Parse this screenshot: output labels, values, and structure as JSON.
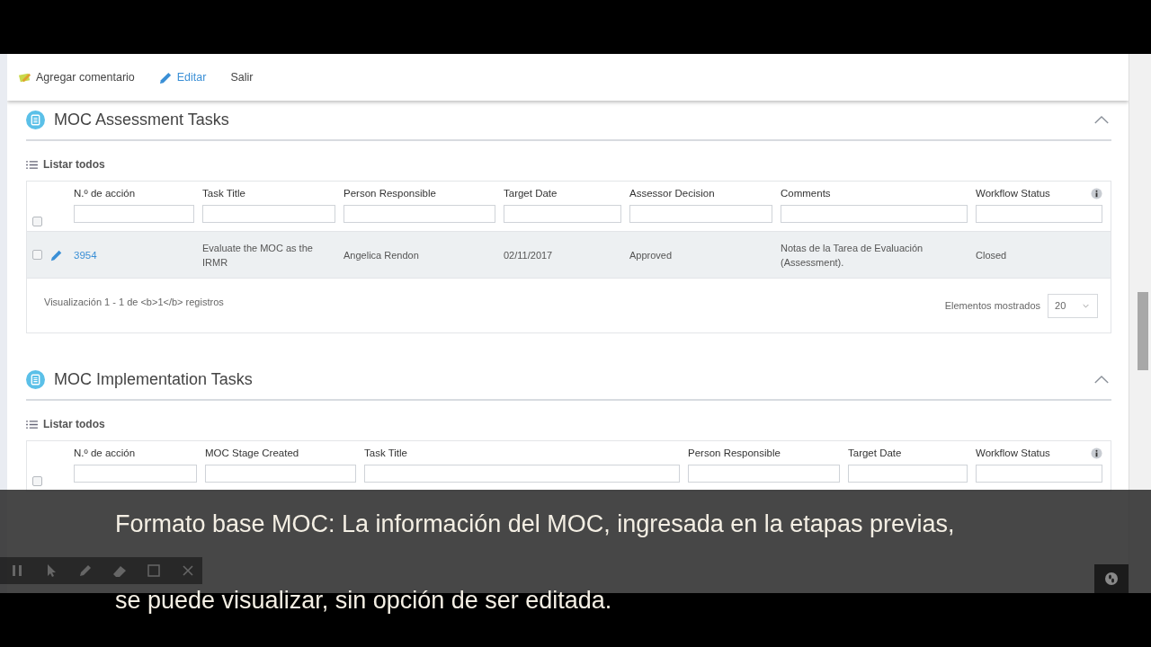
{
  "toolbar": {
    "items": [
      {
        "kind": "comment",
        "label": "Agregar comentario"
      },
      {
        "kind": "edit",
        "label": "Editar"
      },
      {
        "kind": "plain",
        "label": "Salir"
      }
    ]
  },
  "sections": [
    {
      "title": "MOC Assessment Tasks",
      "expanded": true,
      "list_all": "Listar todos",
      "table": {
        "all_checked": false,
        "columns": [
          {
            "label": "N.º de acción"
          },
          {
            "label": "Task Title"
          },
          {
            "label": "Person Responsible"
          },
          {
            "label": "Target Date"
          },
          {
            "label": "Assessor Decision"
          },
          {
            "label": "Comments"
          },
          {
            "label": "Workflow Status",
            "info": true
          }
        ],
        "rows": [
          {
            "checked": false,
            "highlighted": true,
            "cells": [
              "3954",
              "Evaluate the MOC as the IRMR",
              "Angelica Rendon",
              "02/11/2017",
              "Approved",
              "Notas de la Tarea de Evaluación (Assessment).",
              "Closed"
            ]
          }
        ]
      },
      "footer": {
        "summary": "Visualización 1 - 1 de <b>1</b> registros",
        "page_size_label": "Elementos mostrados",
        "page_size": "20"
      }
    },
    {
      "title": "MOC Implementation Tasks",
      "expanded": true,
      "list_all": "Listar todos",
      "table": {
        "all_checked": false,
        "columns": [
          {
            "label": "N.º de acción"
          },
          {
            "label": "MOC Stage Created"
          },
          {
            "label": "Task Title"
          },
          {
            "label": "Person Responsible"
          },
          {
            "label": "Target Date"
          },
          {
            "label": "Workflow Status",
            "info": true
          }
        ]
      }
    }
  ],
  "subtitle": {
    "lines": [
      "Formato base MOC: La información del MOC, ingresada en la etapas previas,",
      "se puede visualizar,  sin opción de ser editada."
    ]
  }
}
